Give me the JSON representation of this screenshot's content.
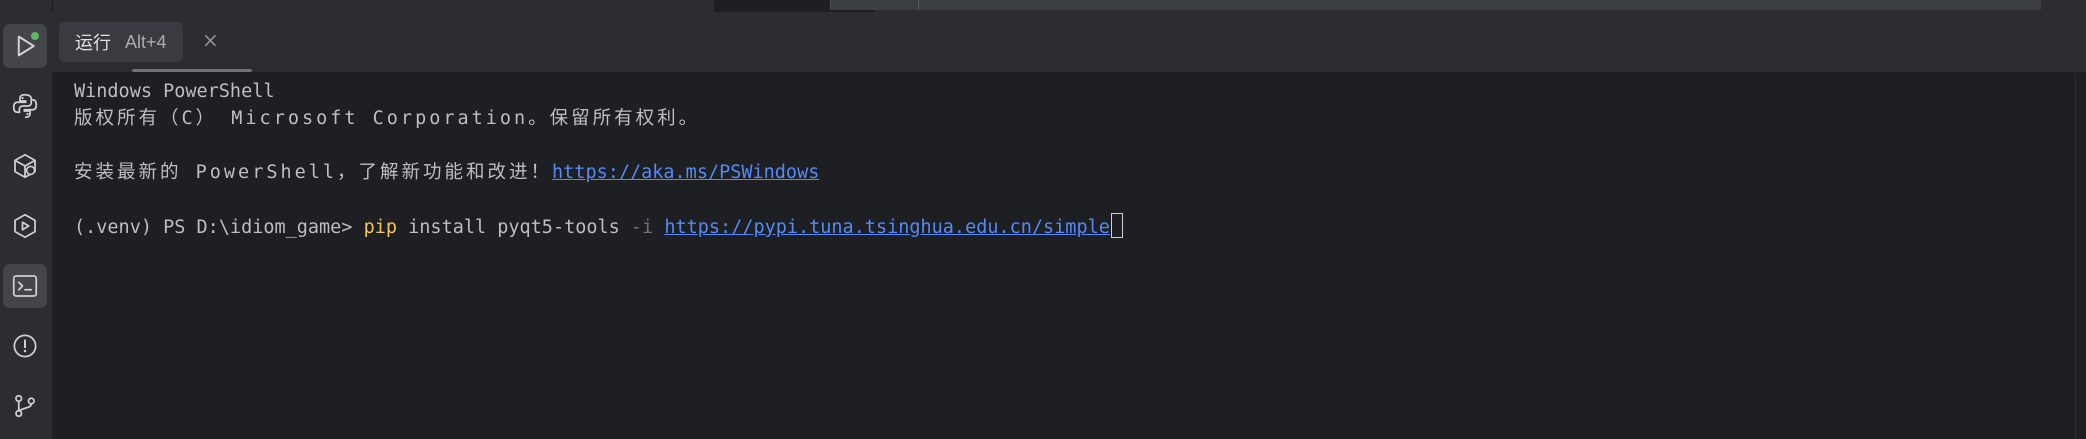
{
  "tab": {
    "label": "运行",
    "shortcut": "Alt+4",
    "close_glyph": "×"
  },
  "toolstrip": {
    "items": [
      {
        "name": "run-icon",
        "active": true,
        "status_dot": "#5fb865"
      },
      {
        "name": "python-console-icon"
      },
      {
        "name": "python-packages-icon"
      },
      {
        "name": "services-icon"
      },
      {
        "name": "terminal-icon",
        "active": true
      },
      {
        "name": "problems-icon"
      },
      {
        "name": "git-icon"
      }
    ]
  },
  "terminal": {
    "line1": "Windows PowerShell",
    "line2": "版权所有（C） Microsoft Corporation。保留所有权利。",
    "line3_prefix": "安装最新的 PowerShell，了解新功能和改进！",
    "line3_link": "https://aka.ms/PSWindows",
    "prompt": "(.venv) PS D:\\idiom_game> ",
    "cmd_pip": "pip",
    "cmd_rest": " install pyqt5-tools ",
    "cmd_flag": "-i",
    "cmd_space": " ",
    "cmd_link": "https://pypi.tuna.tsinghua.edu.cn/simple"
  },
  "colors": {
    "background": "#1e1f22",
    "panel": "#2b2d30",
    "link": "#548af7",
    "command": "#f2c55c",
    "text": "#bcbec4"
  }
}
